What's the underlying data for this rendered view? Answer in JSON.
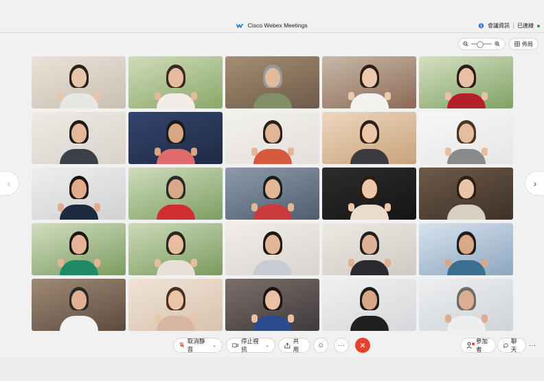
{
  "window": {
    "title": "Cisco Webex Meetings"
  },
  "header": {
    "meeting_info": "會議資訊",
    "connection_status": "已連線"
  },
  "toolbar": {
    "layout_label": "佈局"
  },
  "grid": {
    "tiles": [
      {
        "bg": "#c9c0b2",
        "bg2": "#e8e2d8",
        "shirt": "#e8e6e3",
        "hair": "#2b1f17",
        "skin": "#e9c6ab"
      },
      {
        "bg": "#8aa76a",
        "bg2": "#cfdcb8",
        "shirt": "#f1ece4",
        "hair": "#3a2a1e",
        "skin": "#e6bb9d"
      },
      {
        "bg": "#6d5a48",
        "bg2": "#a58e73",
        "shirt": "#7f8f66",
        "hair": "#9a9a9a",
        "skin": "#e2bb9a"
      },
      {
        "bg": "#8c6a56",
        "bg2": "#c8b8a8",
        "shirt": "#f4f2ef",
        "hair": "#2d1f18",
        "skin": "#ecc8ad"
      },
      {
        "bg": "#7fa165",
        "bg2": "#d5e0c2",
        "shirt": "#b3202a",
        "hair": "#2c1e16",
        "skin": "#e8c0a3"
      },
      {
        "bg": "#d8d2ca",
        "bg2": "#eeeae4",
        "shirt": "#3c4048",
        "hair": "#1e1a18",
        "skin": "#e4b99a"
      },
      {
        "bg": "#1f2a44",
        "bg2": "#33456e",
        "shirt": "#e16a6a",
        "hair": "#1b1b1b",
        "skin": "#d9a683"
      },
      {
        "bg": "#e3dfd9",
        "bg2": "#f3f1ee",
        "shirt": "#d65a3d",
        "hair": "#2b2019",
        "skin": "#e2b596"
      },
      {
        "bg": "#c9a27c",
        "bg2": "#ecd8bf",
        "shirt": "#3b3b40",
        "hair": "#2b1f18",
        "skin": "#ebc6a8"
      },
      {
        "bg": "#e6e6e6",
        "bg2": "#f7f7f7",
        "shirt": "#8a8a8a",
        "hair": "#4a3424",
        "skin": "#e5bea1"
      },
      {
        "bg": "#cfd1d3",
        "bg2": "#eceeef",
        "shirt": "#1c2a3f",
        "hair": "#1b1412",
        "skin": "#e0ac8a"
      },
      {
        "bg": "#7d9e62",
        "bg2": "#cfdcbc",
        "shirt": "#d12c2f",
        "hair": "#2a2a2a",
        "skin": "#d8a988"
      },
      {
        "bg": "#4e5e70",
        "bg2": "#8d9aa8",
        "shirt": "#cc3b3b",
        "hair": "#1d1d1d",
        "skin": "#e3b795"
      },
      {
        "bg": "#141414",
        "bg2": "#2d2d2d",
        "shirt": "#e9dccd",
        "hair": "#2a1c15",
        "skin": "#edc7aa"
      },
      {
        "bg": "#3d3129",
        "bg2": "#6e5a48",
        "shirt": "#d9cfc2",
        "hair": "#2c1f18",
        "skin": "#ebc5a8"
      },
      {
        "bg": "#7c9c60",
        "bg2": "#d2ddc0",
        "shirt": "#1e8b64",
        "hair": "#1e1612",
        "skin": "#e3b596"
      },
      {
        "bg": "#7b9a5f",
        "bg2": "#cddab9",
        "shirt": "#e6e0d8",
        "hair": "#2d2420",
        "skin": "#e7bda0"
      },
      {
        "bg": "#d8d4ce",
        "bg2": "#f1eee9",
        "shirt": "#c8ccd2",
        "hair": "#1c1816",
        "skin": "#e2b797"
      },
      {
        "bg": "#cfcac3",
        "bg2": "#ede9e3",
        "shirt": "#2a2a30",
        "hair": "#202020",
        "skin": "#deb293"
      },
      {
        "bg": "#8ca6bf",
        "bg2": "#d7e3ee",
        "shirt": "#3b6f8f",
        "hair": "#1d1d1d",
        "skin": "#d9a887"
      },
      {
        "bg": "#5b4b3f",
        "bg2": "#a08a74",
        "shirt": "#f1f1f1",
        "hair": "#2a2a2a",
        "skin": "#e0b293"
      },
      {
        "bg": "#d8c3ad",
        "bg2": "#efe3d6",
        "shirt": "#d9b6a1",
        "hair": "#4a3020",
        "skin": "#ecc6a9"
      },
      {
        "bg": "#3e3a3c",
        "bg2": "#7d6f6a",
        "shirt": "#2c4b8f",
        "hair": "#1a1414",
        "skin": "#e9c0a2"
      },
      {
        "bg": "#d7d8db",
        "bg2": "#eff0f2",
        "shirt": "#202020",
        "hair": "#1b1b1b",
        "skin": "#d9a787"
      },
      {
        "bg": "#cfd3d6",
        "bg2": "#edeff1",
        "shirt": "#eeeeee",
        "hair": "#6c6c6c",
        "skin": "#dcae8f"
      }
    ]
  },
  "controls": {
    "mute_label": "取消靜音",
    "video_label": "停止視訊",
    "share_label": "共用",
    "participants_label": "參加者",
    "chat_label": "聊天"
  },
  "colors": {
    "end_call": "#e5412d",
    "connected": "#2ea043",
    "webex": "#1b6fd1"
  }
}
